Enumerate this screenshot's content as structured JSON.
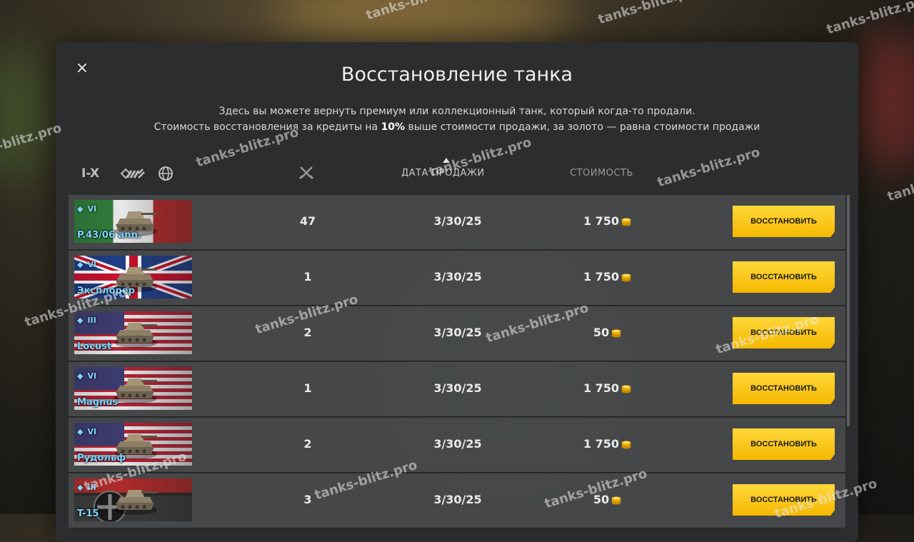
{
  "dialog": {
    "close_symbol": "×",
    "title": "Восстановление танка",
    "subtitle_line1": "Здесь вы можете вернуть премиум или коллекционный танк, который когда-то продали.",
    "subtitle_line2_a": "Стоимость восстановления за кредиты на ",
    "subtitle_line2_bold": "10%",
    "subtitle_line2_b": " выше стоимости продажи, за золото — равна стоимости продажи"
  },
  "filters": {
    "tier_label": "I-X",
    "class_icon": "tank-class-icon",
    "nation_icon": "globe-icon"
  },
  "columns": {
    "battles_icon": "crossed-swords-icon",
    "date": "ДАТА ПРОДАЖИ",
    "price": "СТОИМОСТЬ",
    "sort_icon": "sort-up-icon"
  },
  "rows": [
    {
      "tier": "VI",
      "name": "P.43/06 ann.",
      "nation": "italy",
      "battles": "47",
      "date": "3/30/25",
      "price": "1 750",
      "currency": "gold-coins",
      "action": "ВОССТАНОВИТЬ"
    },
    {
      "tier": "VI",
      "name": "Эксплорер",
      "nation": "uk",
      "battles": "1",
      "date": "3/30/25",
      "price": "1 750",
      "currency": "gold-coins",
      "action": "ВОССТАНОВИТЬ"
    },
    {
      "tier": "III",
      "name": "Locust",
      "nation": "usa",
      "battles": "2",
      "date": "3/30/25",
      "price": "50",
      "currency": "gold-coins",
      "action": "ВОССТАНОВИТЬ"
    },
    {
      "tier": "VI",
      "name": "Magnus",
      "nation": "usa",
      "battles": "1",
      "date": "3/30/25",
      "price": "1 750",
      "currency": "gold-coins",
      "action": "ВОССТАНОВИТЬ"
    },
    {
      "tier": "VI",
      "name": "Рудольф",
      "nation": "usa",
      "battles": "2",
      "date": "3/30/25",
      "price": "1 750",
      "currency": "gold-coins",
      "action": "ВОССТАНОВИТЬ"
    },
    {
      "tier": "III",
      "name": "T-15",
      "nation": "germany",
      "battles": "3",
      "date": "3/30/25",
      "price": "50",
      "currency": "gold-coins",
      "action": "ВОССТАНОВИТЬ"
    }
  ],
  "watermark": "tanks-blitz.pro",
  "colors": {
    "accent_button": "#f5b800",
    "tank_name": "#7fd4ff",
    "modal_bg": "#2c2d2e"
  }
}
